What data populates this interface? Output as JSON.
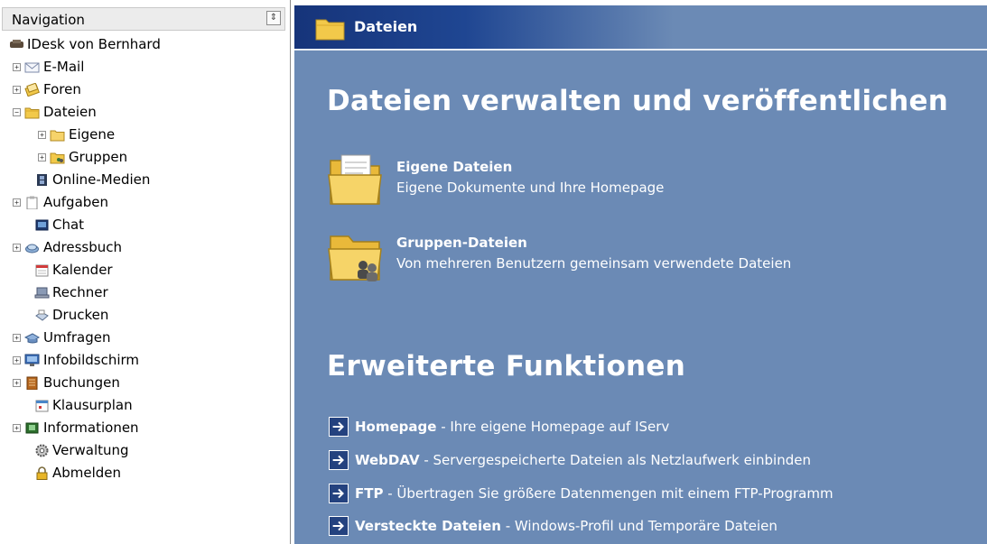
{
  "nav": {
    "title": "Navigation",
    "toggle": "⇕",
    "items": [
      {
        "label": "IDesk von Bernhard",
        "icon": "desk-icon",
        "expander": ""
      },
      {
        "label": "E-Mail",
        "icon": "envelope-icon",
        "expander": "+"
      },
      {
        "label": "Foren",
        "icon": "forum-icon",
        "expander": "+"
      },
      {
        "label": "Dateien",
        "icon": "folder-icon",
        "expander": "−"
      },
      {
        "label": "Eigene",
        "icon": "folder-icon",
        "expander": "+"
      },
      {
        "label": "Gruppen",
        "icon": "group-folder-icon",
        "expander": "+"
      },
      {
        "label": "Online-Medien",
        "icon": "film-icon",
        "expander": ""
      },
      {
        "label": "Aufgaben",
        "icon": "clipboard-icon",
        "expander": "+"
      },
      {
        "label": "Chat",
        "icon": "chat-icon",
        "expander": ""
      },
      {
        "label": "Adressbuch",
        "icon": "addressbook-icon",
        "expander": "+"
      },
      {
        "label": "Kalender",
        "icon": "calendar-icon",
        "expander": ""
      },
      {
        "label": "Rechner",
        "icon": "computer-icon",
        "expander": ""
      },
      {
        "label": "Drucken",
        "icon": "printer-icon",
        "expander": ""
      },
      {
        "label": "Umfragen",
        "icon": "survey-icon",
        "expander": "+"
      },
      {
        "label": "Infobildschirm",
        "icon": "monitor-icon",
        "expander": "+"
      },
      {
        "label": "Buchungen",
        "icon": "booking-icon",
        "expander": "+"
      },
      {
        "label": "Klausurplan",
        "icon": "schedule-icon",
        "expander": ""
      },
      {
        "label": "Informationen",
        "icon": "info-icon",
        "expander": "+"
      },
      {
        "label": "Verwaltung",
        "icon": "gear-icon",
        "expander": ""
      },
      {
        "label": "Abmelden",
        "icon": "lock-icon",
        "expander": ""
      }
    ]
  },
  "main": {
    "tab_title": "Dateien",
    "heading": "Dateien verwalten und veröffentlichen",
    "items": [
      {
        "title": "Eigene Dateien",
        "desc": "Eigene Dokumente und Ihre Homepage",
        "icon": "folder-documents-icon"
      },
      {
        "title": "Gruppen-Dateien",
        "desc": "Von mehreren Benutzern gemeinsam verwendete Dateien",
        "icon": "group-folder-icon"
      }
    ],
    "section2_heading": "Erweiterte Funktionen",
    "links": [
      {
        "name": "Homepage",
        "desc": " - Ihre eigene Homepage auf IServ"
      },
      {
        "name": "WebDAV",
        "desc": " - Servergespeicherte Dateien als Netzlaufwerk einbinden"
      },
      {
        "name": "FTP",
        "desc": " - Übertragen Sie größere Datenmengen mit einem FTP-Programm"
      },
      {
        "name": "Versteckte Dateien",
        "desc": " - Windows-Profil und Temporäre Dateien"
      }
    ]
  },
  "colors": {
    "content_bg": "#6b8ab5",
    "tab_dark": "#16347a",
    "folder_yellow": "#f2c94a"
  }
}
